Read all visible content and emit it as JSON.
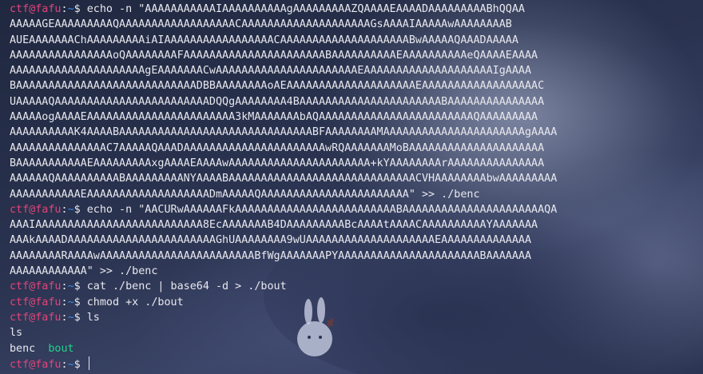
{
  "prompt": {
    "user_host": "ctf@fafu",
    "separator": ":",
    "path": "~",
    "symbol": "$ "
  },
  "lines": [
    {
      "kind": "cmd",
      "text": "echo -n \"AAAAAAAAAAAIAAAAAAAAAAgAAAAAAAAAZQAAAAEAAAADAAAAAAAAABhQQAA"
    },
    {
      "kind": "out",
      "text": "AAAAAGEAAAAAAAAAQAAAAAAAAAAAAAAAAAACAAAAAAAAAAAAAAAAAAAAGsAAAAIAAAAAwAAAAAAAAB"
    },
    {
      "kind": "out",
      "text": "AUEAAAAAAAChAAAAAAAAAiAIAAAAAAAAAAAAAAAAACAAAAAAAAAAAAAAAAAAAABwAAAAAQAAADAAAAA"
    },
    {
      "kind": "out",
      "text": "AAAAAAAAAAAAAAAAoQAAAAAAAAFAAAAAAAAAAAAAAAAAAAAAABAAAAAAAAAAEAAAAAAAAAAeQAAAAEAAAA"
    },
    {
      "kind": "out",
      "text": "AAAAAAAAAAAAAAAAAAAAAgEAAAAAAACwAAAAAAAAAAAAAAAAAAAAAAEAAAAAAAAAAAAAAAAAAAAIgAAAA"
    },
    {
      "kind": "out",
      "text": "BAAAAAAAAAAAAAAAAAAAAAAAAAAAADBBAAAAAAAAoAEAAAAAAAAAAAAAAAAAAAAEAAAAAAAAAAAAAAAAAAC"
    },
    {
      "kind": "out",
      "text": "UAAAAAQAAAAAAAAAAAAAAAAAAAAAAAADQQgAAAAAAAA4BAAAAAAAAAAAAAAAAAAAAAABAAAAAAAAAAAAAAA"
    },
    {
      "kind": "out",
      "text": "AAAAAogAAAAEAAAAAAAAAAAAAAAAAAAAAAA3kMAAAAAAAbAQAAAAAAAAAAAAAAAAAAAAAAAAQAAAAAAAAA"
    },
    {
      "kind": "out",
      "text": "AAAAAAAAAAK4AAAABAAAAAAAAAAAAAAAAAAAAAAAAAAAAAABFAAAAAAAAMAAAAAAAAAAAAAAAAAAAAAAgAAAA"
    },
    {
      "kind": "out",
      "text": "AAAAAAAAAAAAAAAC7AAAAAQAAADAAAAAAAAAAAAAAAAAAAAAAwRQAAAAAAAMoBAAAAAAAAAAAAAAAAAAAAA"
    },
    {
      "kind": "out",
      "text": "BAAAAAAAAAAAEAAAAAAAAAxgAAAAEAAAAwAAAAAAAAAAAAAAAAAAAAAA+kYAAAAAAAArAAAAAAAAAAAAAAA"
    },
    {
      "kind": "out",
      "text": "AAAAAAQAAAAAAAAAABAAAAAAAAANYAAAABAAAAAAAAAAAAAAAAAAAAAAAAAAAAACVHAAAAAAAAbwAAAAAAAAA"
    },
    {
      "kind": "out",
      "text": "AAAAAAAAAAAEAAAAAAAAAAAAAAAAAAADmAAAAAQAAAAAAAAAAAAAAAAAAAAAAA\" >> ./benc"
    },
    {
      "kind": "cmd",
      "text": "echo -n \"AACURwAAAAAAFkAAAAAAAAAAAAAAAAAAAAAAAAABAAAAAAAAAAAAAAAAAAAAAAQA"
    },
    {
      "kind": "out",
      "text": "AAAIAAAAAAAAAAAAAAAAAAAAAAAAAA8EcAAAAAAAB4DAAAAAAAAABcAAAAtAAAACAAAAAAAAAAYAAAAAAA"
    },
    {
      "kind": "out",
      "text": "AAAkAAAADAAAAAAAAAAAAAAAAAAAAAAAGhUAAAAAAAA9wUAAAAAAAAAAAAAAAAAAAAEAAAAAAAAAAAAAA"
    },
    {
      "kind": "out",
      "text": "AAAAAAAARAAAAwAAAAAAAAAAAAAAAAAAAAAAAABfWgAAAAAAAPYAAAAAAAAAAAAAAAAAAAAAABAAAAAAA"
    },
    {
      "kind": "out",
      "text": "AAAAAAAAAAAA\" >> ./benc"
    },
    {
      "kind": "cmd",
      "text": "cat ./benc | base64 -d > ./bout"
    },
    {
      "kind": "cmd",
      "text": "chmod +x ./bout"
    },
    {
      "kind": "cmd",
      "text": "ls"
    },
    {
      "kind": "out",
      "text": "ls"
    },
    {
      "kind": "ls",
      "items": [
        {
          "name": "benc",
          "type": "file"
        },
        {
          "name": "bout",
          "type": "exec"
        }
      ]
    },
    {
      "kind": "cmd",
      "text": "",
      "cursor": true
    }
  ],
  "colors": {
    "user": "#e0457b",
    "path": "#3b8eea",
    "text": "#e8e8ee",
    "exec": "#23d18b"
  },
  "icons": {
    "background": "bunny-wallpaper"
  }
}
